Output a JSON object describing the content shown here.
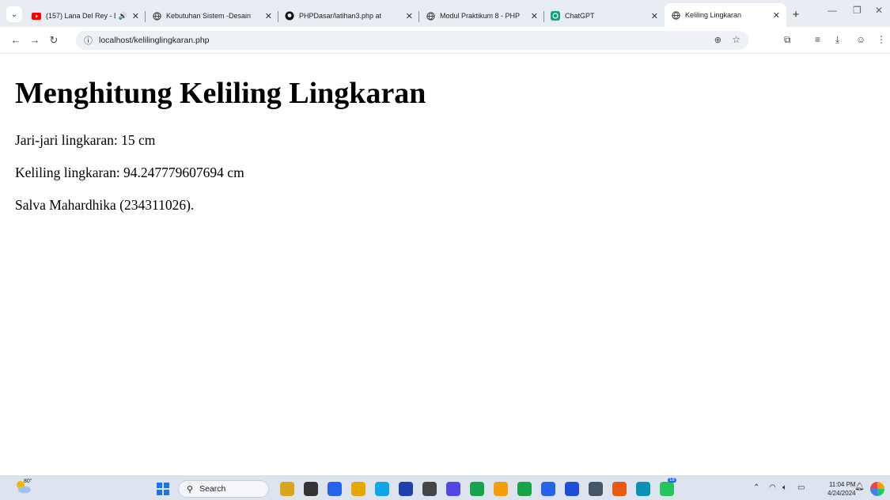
{
  "browser": {
    "tabs": [
      {
        "title": "(157) Lana Del Rey - D",
        "favicon": "youtube-icon",
        "audio": true,
        "active": false
      },
      {
        "title": "Kebutuhan Sistem -Desain",
        "favicon": "globe-icon",
        "active": false
      },
      {
        "title": "PHPDasar/latihan3.php at",
        "favicon": "github-icon",
        "active": false
      },
      {
        "title": "Modul Praktikum 8 - PHP",
        "favicon": "globe-icon",
        "active": false
      },
      {
        "title": "ChatGPT",
        "favicon": "chatgpt-icon",
        "active": false
      },
      {
        "title": "Keliling Lingkaran",
        "favicon": "globe-icon",
        "active": true
      }
    ],
    "url": "localhost/kelilinglingkaran.php"
  },
  "page": {
    "heading": "Menghitung Keliling Lingkaran",
    "radius_line": "Jari-jari lingkaran: 15 cm",
    "circumference_line": "Keliling lingkaran: 94.247779607694 cm",
    "author_line": "Salva Mahardhika (234311026)."
  },
  "taskbar": {
    "weather_temp": "80°",
    "search_label": "Search",
    "time": "11:04 PM",
    "date": "4/24/2024",
    "whatsapp_badge": "18",
    "app_colors": [
      "#d9a51f",
      "#333333",
      "#2563eb",
      "#e6a800",
      "#0ea5e9",
      "#1e40af",
      "#444444",
      "#4f46e5",
      "#16a34a",
      "#f59e0b",
      "#16a34a",
      "#2563eb",
      "#1d4ed8",
      "#475569",
      "#ea580c",
      "#0891b2",
      "#22c55e"
    ]
  }
}
